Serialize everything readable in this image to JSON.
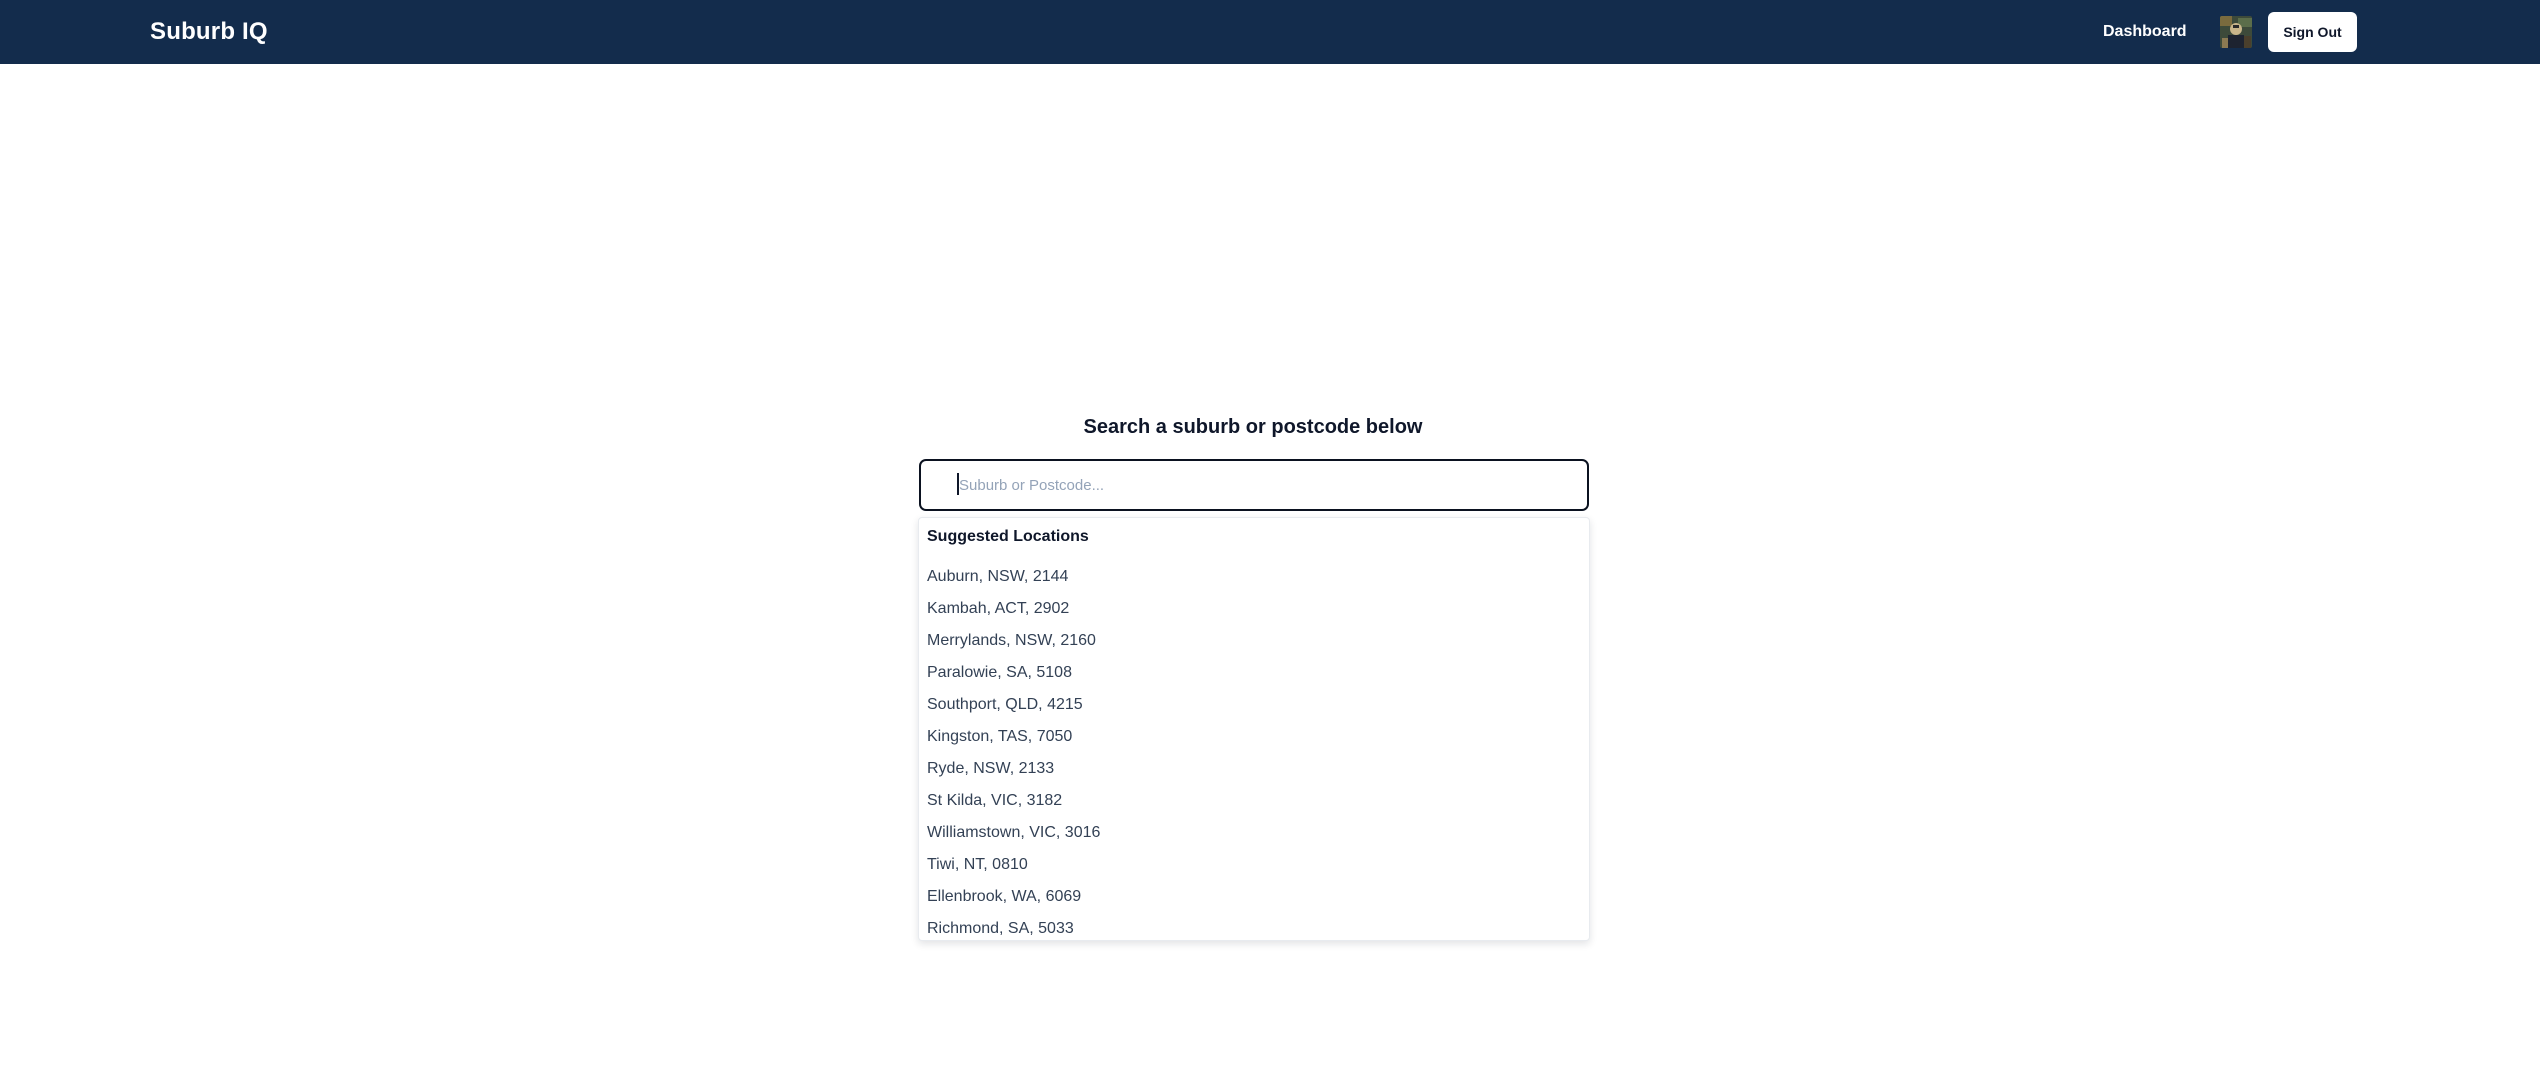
{
  "header": {
    "brand": "Suburb IQ",
    "nav_dashboard": "Dashboard",
    "sign_out_label": "Sign Out",
    "background_color": "#132c4c"
  },
  "search": {
    "heading": "Search a suburb or postcode below",
    "placeholder": "Suburb or Postcode...",
    "value": ""
  },
  "suggestions": {
    "heading": "Suggested Locations",
    "items": [
      "Auburn, NSW, 2144",
      "Kambah, ACT, 2902",
      "Merrylands, NSW, 2160",
      "Paralowie, SA, 5108",
      "Southport, QLD, 4215",
      "Kingston, TAS, 7050",
      "Ryde, NSW, 2133",
      "St Kilda, VIC, 3182",
      "Williamstown, VIC, 3016",
      "Tiwi, NT, 0810",
      "Ellenbrook, WA, 6069",
      "Richmond, SA, 5033"
    ]
  }
}
